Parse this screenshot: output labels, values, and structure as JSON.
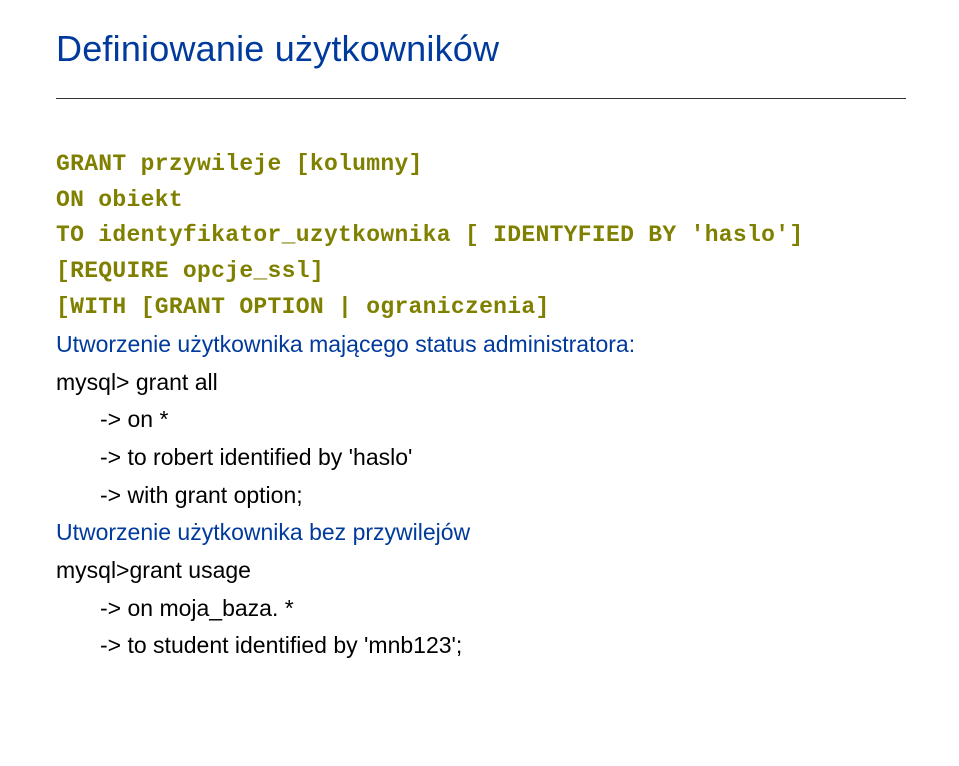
{
  "title": "Definiowanie użytkowników",
  "syntax": {
    "l1": "GRANT przywileje [kolumny]",
    "l2": "ON obiekt",
    "l3": "TO identyfikator_uzytkownika [ IDENTYFIED BY 'haslo']",
    "l4": "[REQUIRE opcje_ssl]",
    "l5": "[WITH [GRANT OPTION | ograniczenia]"
  },
  "sec1": {
    "heading": "Utworzenie użytkownika mającego status administratora:",
    "l1": "mysql> grant all",
    "l2": "-> on *",
    "l3": "-> to robert identified by 'haslo'",
    "l4": "-> with grant option;"
  },
  "sec2": {
    "heading": "Utworzenie użytkownika bez przywilejów",
    "l1": "mysql>grant usage",
    "l2": "-> on  moja_baza. *",
    "l3": "-> to student identified by 'mnb123';"
  }
}
